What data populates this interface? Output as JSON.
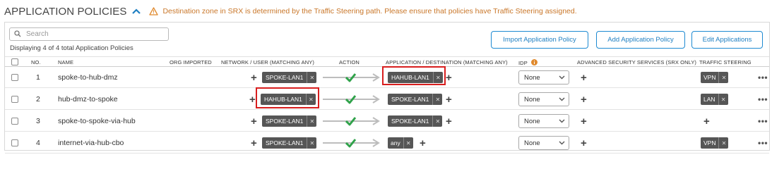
{
  "header": {
    "title": "APPLICATION POLICIES",
    "warning": "Destination zone in SRX is determined by the Traffic Steering path. Please ensure that policies have Traffic Steering assigned."
  },
  "search": {
    "placeholder": "Search"
  },
  "count_text": "Displaying 4 of 4 total Application Policies",
  "buttons": {
    "import": "Import Application Policy",
    "add": "Add Application Policy",
    "edit": "Edit Applications"
  },
  "columns": {
    "no": "NO.",
    "name": "NAME",
    "org_imported": "ORG IMPORTED",
    "network": "NETWORK / USER (MATCHING ANY)",
    "action": "ACTION",
    "application": "APPLICATION / DESTINATION (MATCHING ANY)",
    "idp": "IDP",
    "advanced": "ADVANCED SECURITY SERVICES (SRX ONLY)",
    "traffic": "TRAFFIC STEERING"
  },
  "rows": [
    {
      "no": "1",
      "name": "spoke-to-hub-dmz",
      "network": "SPOKE-LAN1",
      "application": "HAHUB-LAN1",
      "idp": "None",
      "traffic": "VPN"
    },
    {
      "no": "2",
      "name": "hub-dmz-to-spoke",
      "network": "HAHUB-LAN1",
      "application": "SPOKE-LAN1",
      "idp": "None",
      "traffic": "LAN"
    },
    {
      "no": "3",
      "name": "spoke-to-spoke-via-hub",
      "network": "SPOKE-LAN1",
      "application": "SPOKE-LAN1",
      "idp": "None",
      "traffic": ""
    },
    {
      "no": "4",
      "name": "internet-via-hub-cbo",
      "network": "SPOKE-LAN1",
      "application": "any",
      "idp": "None",
      "traffic": "VPN"
    }
  ],
  "icons": {
    "collapse": "chevron-up-icon",
    "warning": "warning-triangle-icon",
    "search": "search-icon",
    "info": "info-icon",
    "action": "allow-arrow-check-icon",
    "more": "more-horizontal-icon"
  },
  "colors": {
    "accent": "#1e8ad2",
    "warning": "#e08a2e",
    "allow_check": "#2fa24a",
    "highlight": "#d81e1e",
    "tag_bg": "#565656"
  }
}
